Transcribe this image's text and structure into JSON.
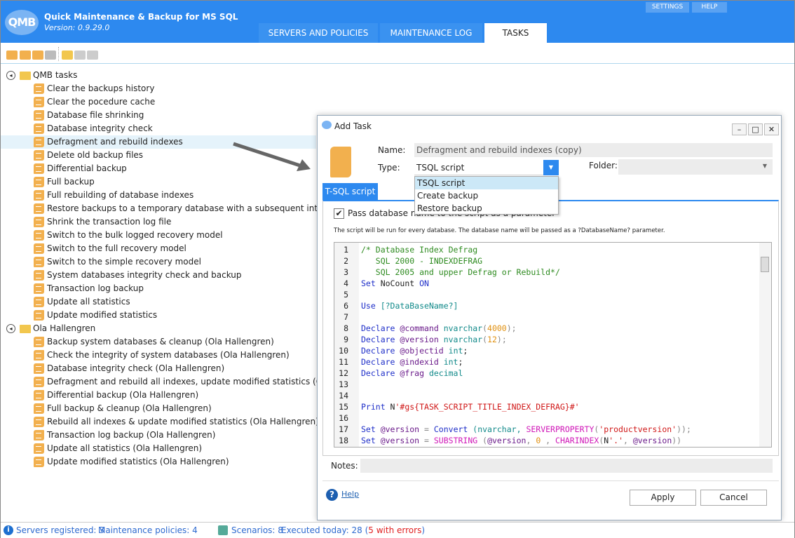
{
  "app": {
    "logo": "QMB",
    "title": "Quick Maintenance & Backup for MS SQL",
    "version": "Version: 0.9.29.0",
    "settings": "SETTINGS",
    "help": "HELP"
  },
  "tabs": [
    {
      "label": "SERVERS AND POLICIES"
    },
    {
      "label": "MAINTENANCE LOG"
    },
    {
      "label": "TASKS"
    }
  ],
  "toolbar": [
    "add-task-icon",
    "import-task-icon",
    "edit-task-icon",
    "delete-task-icon",
    "add-folder-icon",
    "edit-folder-icon",
    "delete-folder-icon"
  ],
  "tree": {
    "qmb": {
      "label": "QMB tasks",
      "items": [
        "Clear the backups history",
        "Clear the pocedure cache",
        "Database file shrinking",
        "Database integrity check",
        "Defragment and rebuild indexes",
        "Delete old backup files",
        "Differential backup",
        "Full backup",
        "Full rebuilding of database indexes",
        "Restore backups to a temporary database with a subsequent integrity che",
        "Shrink the transaction log file",
        "Switch to the bulk logged recovery model",
        "Switch to the full recovery model",
        "Switch to the simple recovery model",
        "System databases integrity check and backup",
        "Transaction log backup",
        "Update all statistics",
        "Update modified statistics"
      ]
    },
    "ola": {
      "label": "Ola Hallengren",
      "items": [
        "Backup system databases & cleanup (Ola Hallengren)",
        "Check the integrity of system databases (Ola Hallengren)",
        "Database integrity check (Ola Hallengren)",
        "Defragment and rebuild  all indexes, update modified statistics (Ola Halle",
        "Differential backup (Ola Hallengren)",
        "Full backup & cleanup (Ola Hallengren)",
        "Rebuild all indexes & update modified statistics (Ola Hallengren)",
        "Transaction log backup (Ola Hallengren)",
        "Update all statistics (Ola Hallengren)",
        "Update modified statistics (Ola Hallengren)"
      ]
    },
    "selected": "Defragment and rebuild indexes"
  },
  "dialog": {
    "title": "Add Task",
    "minimize": "–",
    "maximize": "□",
    "close": "✕",
    "name_label": "Name:",
    "name_value": "Defragment and rebuild indexes (copy)",
    "type_label": "Type:",
    "type_value": "TSQL script",
    "type_options": [
      "TSQL script",
      "Create backup",
      "Restore backup"
    ],
    "folder_label": "Folder:",
    "folder_value": "",
    "tab": "T-SQL script",
    "checkbox_label": "Pass database name to the script as a parameter",
    "checkbox_checked": true,
    "hint": "The script will be run for every database. The database name will be passed as a ?DatabaseName? parameter.",
    "code": [
      [
        [
          "c",
          "/* Database Index Defrag"
        ]
      ],
      [
        [
          "c",
          "   SQL 2000 - INDEXDEFRAG"
        ]
      ],
      [
        [
          "c",
          "   SQL 2005 and upper Defrag or Rebuild*/"
        ]
      ],
      [
        [
          "k",
          "Set "
        ],
        [
          "p",
          "NoCount "
        ],
        [
          "k",
          "ON"
        ]
      ],
      [],
      [
        [
          "k",
          "Use "
        ],
        [
          "t",
          "[?DataBaseName?]"
        ]
      ],
      [],
      [
        [
          "k",
          "Declare "
        ],
        [
          "v",
          "@command "
        ],
        [
          "t",
          "nvarchar"
        ],
        [
          "g",
          "("
        ],
        [
          "n",
          "4000"
        ],
        [
          "g",
          ");"
        ]
      ],
      [
        [
          "k",
          "Declare "
        ],
        [
          "v",
          "@version "
        ],
        [
          "t",
          "nvarchar"
        ],
        [
          "g",
          "("
        ],
        [
          "n",
          "12"
        ],
        [
          "g",
          ");"
        ]
      ],
      [
        [
          "k",
          "Declare "
        ],
        [
          "v",
          "@objectid "
        ],
        [
          "t",
          "int"
        ],
        [
          "p",
          ";"
        ]
      ],
      [
        [
          "k",
          "Declare "
        ],
        [
          "v",
          "@indexid "
        ],
        [
          "t",
          "int"
        ],
        [
          "p",
          ";"
        ]
      ],
      [
        [
          "k",
          "Declare "
        ],
        [
          "v",
          "@frag "
        ],
        [
          "t",
          "decimal"
        ]
      ],
      [],
      [],
      [
        [
          "k",
          "Print "
        ],
        [
          "p",
          "N"
        ],
        [
          "s",
          "'#gs{TASK_SCRIPT_TITLE_INDEX_DEFRAG}#'"
        ]
      ],
      [],
      [
        [
          "k",
          "Set "
        ],
        [
          "v",
          "@version "
        ],
        [
          "g",
          "= "
        ],
        [
          "k",
          "Convert "
        ],
        [
          "t",
          "(nvarchar, "
        ],
        [
          "f",
          "SERVERPROPERTY"
        ],
        [
          "g",
          "("
        ],
        [
          "s",
          "'productversion'"
        ],
        [
          "g",
          "));"
        ]
      ],
      [
        [
          "k",
          "Set "
        ],
        [
          "v",
          "@version "
        ],
        [
          "g",
          "= "
        ],
        [
          "f",
          "SUBSTRING "
        ],
        [
          "g",
          "("
        ],
        [
          "v",
          "@version"
        ],
        [
          "g",
          ", "
        ],
        [
          "n",
          "0"
        ],
        [
          "g",
          " , "
        ],
        [
          "f",
          "CHARINDEX"
        ],
        [
          "g",
          "("
        ],
        [
          "p",
          "N"
        ],
        [
          "s",
          "'.'"
        ],
        [
          "g",
          ", "
        ],
        [
          "v",
          "@version"
        ],
        [
          "g",
          "))"
        ]
      ]
    ],
    "notes_label": "Notes:",
    "notes_value": "",
    "help": "Help",
    "apply": "Apply",
    "cancel": "Cancel"
  },
  "status": {
    "servers": "Servers registered: 3",
    "policies": "Maintenance policies: 4",
    "scenarios": "Scenarios: 8",
    "executed": "Executed today: 28 (",
    "errors": "5 with errors",
    "close_paren": ")",
    "error_color": "#e02020",
    "accent": "#2d89ef"
  }
}
